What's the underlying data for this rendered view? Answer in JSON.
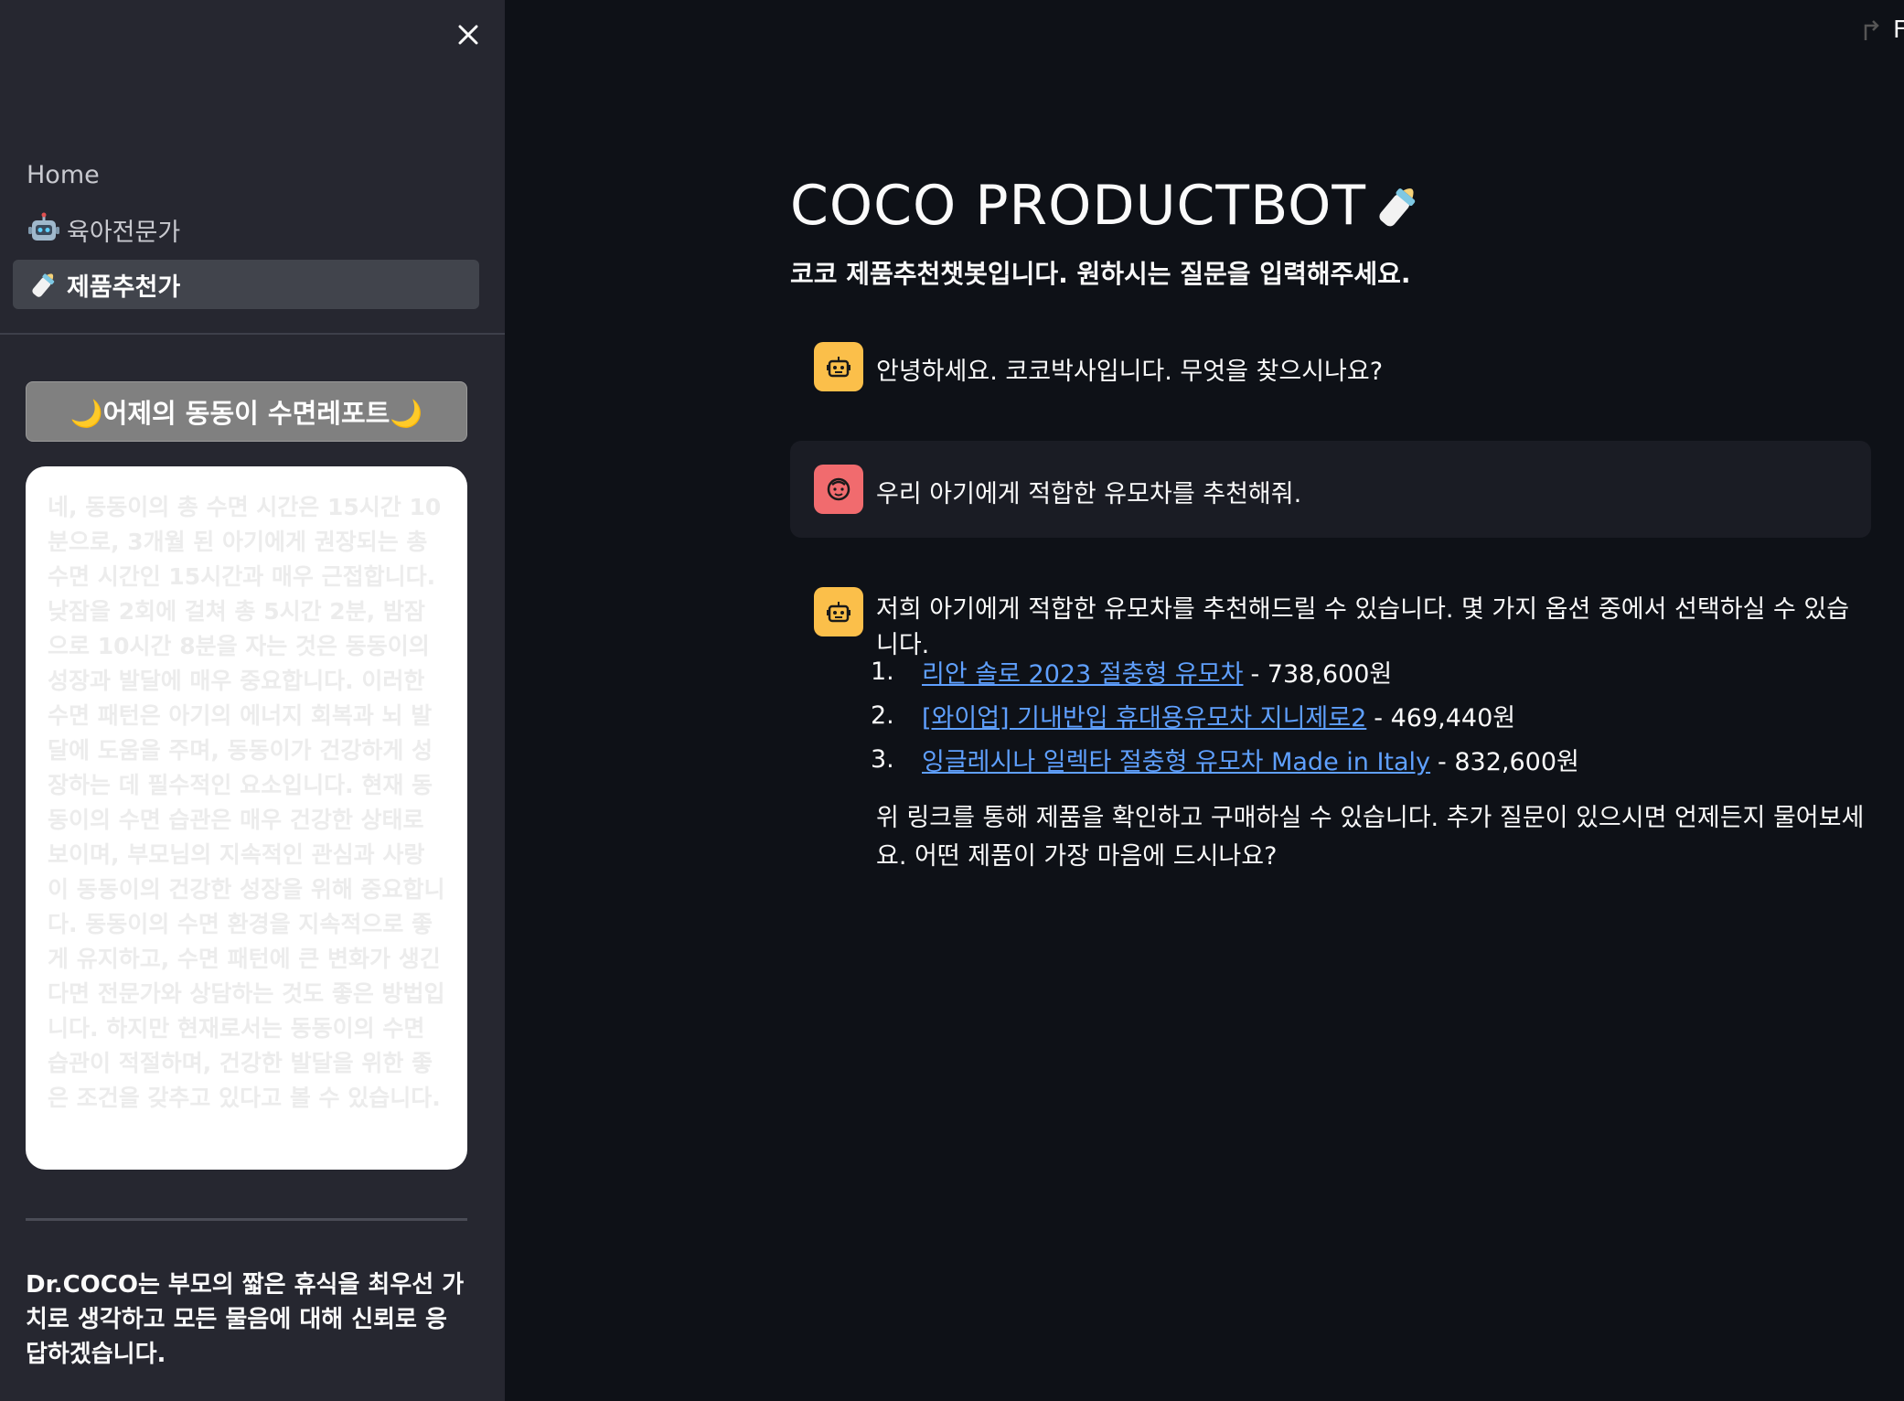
{
  "sidebar": {
    "nav": [
      {
        "label": "Home"
      },
      {
        "label": "육아전문가"
      },
      {
        "label": "제품추천가"
      }
    ],
    "report_button": "🌙어제의 동동이 수면레포트🌙",
    "report_text": "네, 동동이의 총 수면 시간은 15시간 10분으로, 3개월 된 아기에게 권장되는 총 수면 시간인 15시간과 매우 근접합니다. 낮잠을 2회에 걸쳐 총 5시간 2분, 밤잠으로 10시간 8분을 자는 것은 동동이의 성장과 발달에 매우 중요합니다. 이러한 수면 패턴은 아기의 에너지 회복과 뇌 발달에 도움을 주며, 동동이가 건강하게 성장하는 데 필수적인 요소입니다. 현재 동동이의 수면 습관은 매우 건강한 상태로 보이며, 부모님의 지속적인 관심과 사랑이 동동이의 건강한 성장을 위해 중요합니다. 동동이의 수면 환경을 지속적으로 좋게 유지하고, 수면 패턴에 큰 변화가 생긴다면 전문가와 상담하는 것도 좋은 방법입니다. 하지만 현재로서는 동동이의 수면 습관이 적절하며, 건강한 발달을 위한 좋은 조건을 갖추고 있다고 볼 수 있습니다.",
    "footer": "Dr.COCO는 부모의 짧은 휴식을 최우선 가치로 생각하고 모든 물음에 대해 신뢰로 응답하겠습니다."
  },
  "header": {
    "corner_char": "F"
  },
  "main": {
    "title": "COCO PRODUCTBOT",
    "subtitle": "코코 제품추천챗봇입니다. 원하시는 질문을 입력해주세요."
  },
  "messages": {
    "greeting": "안녕하세요. 코코박사입니다. 무엇을 찾으시나요?",
    "user": "우리 아기에게 적합한 유모차를 추천해줘.",
    "reply_intro": "저희 아기에게 적합한 유모차를 추천해드릴 수 있습니다. 몇 가지 옵션 중에서 선택하실 수 있습니다.",
    "recommendations": [
      {
        "num": "1.",
        "name": "리안 솔로 2023 절충형 유모차",
        "price": "- 738,600원"
      },
      {
        "num": "2.",
        "name": "[와이업] 기내반입 휴대용유모차 지니제로2",
        "price": "- 469,440원"
      },
      {
        "num": "3.",
        "name": "잉글레시나 일렉타 절충형 유모차 Made in Italy",
        "price": "- 832,600원"
      }
    ],
    "reply_closing": "위 링크를 통해 제품을 확인하고 구매하실 수 있습니다. 추가 질문이 있으시면 언제든지 물어보세요. 어떤 제품이 가장 마음에 드시나요?"
  },
  "colors": {
    "background": "#0e1117",
    "sidebar": "#262730",
    "bot_avatar": "#fbbf4a",
    "user_avatar": "#f16b6e",
    "link": "#5fa0ff"
  },
  "icons": {
    "close": "close-icon",
    "robot": "robot-icon",
    "baby_bottle": "baby-bottle-icon",
    "user_face": "user-face-icon"
  }
}
